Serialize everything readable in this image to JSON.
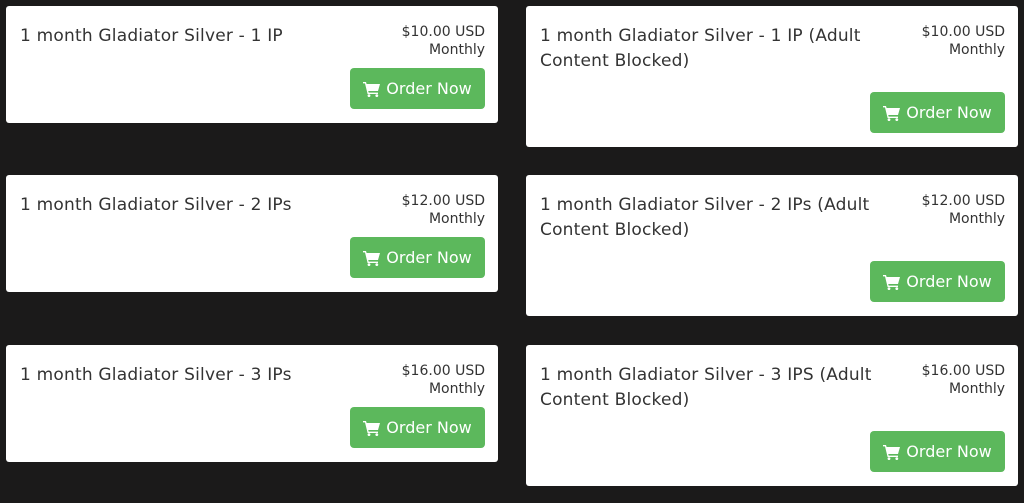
{
  "products": [
    {
      "name": "1 month Gladiator Silver - 1 IP",
      "price": "$10.00 USD",
      "cycle": "Monthly",
      "button": "Order Now"
    },
    {
      "name": "1 month Gladiator Silver - 1 IP (Adult Content Blocked)",
      "price": "$10.00 USD",
      "cycle": "Monthly",
      "button": "Order Now"
    },
    {
      "name": "1 month Gladiator Silver - 2 IPs",
      "price": "$12.00 USD",
      "cycle": "Monthly",
      "button": "Order Now"
    },
    {
      "name": "1 month Gladiator Silver - 2 IPs (Adult Content Blocked)",
      "price": "$12.00 USD",
      "cycle": "Monthly",
      "button": "Order Now"
    },
    {
      "name": "1 month Gladiator Silver - 3 IPs",
      "price": "$16.00 USD",
      "cycle": "Monthly",
      "button": "Order Now"
    },
    {
      "name": "1 month Gladiator Silver - 3 IPS (Adult Content Blocked)",
      "price": "$16.00 USD",
      "cycle": "Monthly",
      "button": "Order Now"
    }
  ],
  "colors": {
    "page_background": "#1b1a1a",
    "card_background": "#ffffff",
    "button_green": "#5cb85c",
    "text": "#333333"
  },
  "icons": {
    "button_icon": "shopping-cart-icon"
  }
}
